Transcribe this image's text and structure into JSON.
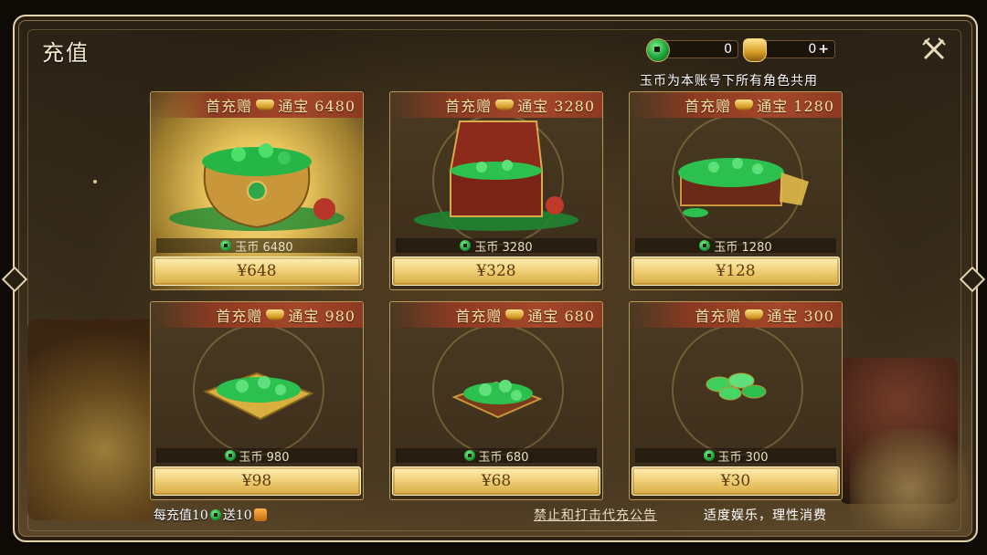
{
  "window": {
    "title": "充值"
  },
  "currency": {
    "jade": {
      "icon": "jade-coin-icon",
      "value": "0"
    },
    "ingot": {
      "icon": "gold-ingot-icon",
      "value": "0",
      "plus": "+"
    }
  },
  "note_shared": "玉币为本账号下所有角色共用",
  "packages": [
    {
      "bonus_prefix": "首充赠",
      "bonus_suffix": "通宝 6480",
      "amount_label": "玉币 6480",
      "price": "¥648",
      "art": "jade-pot"
    },
    {
      "bonus_prefix": "首充赠",
      "bonus_suffix": "通宝 3280",
      "amount_label": "玉币 3280",
      "price": "¥328",
      "art": "treasure-chest"
    },
    {
      "bonus_prefix": "首充赠",
      "bonus_suffix": "通宝 1280",
      "amount_label": "玉币 1280",
      "price": "¥128",
      "art": "coin-box"
    },
    {
      "bonus_prefix": "首充赠",
      "bonus_suffix": "通宝 980",
      "amount_label": "玉币 980",
      "price": "¥98",
      "art": "coin-cloth"
    },
    {
      "bonus_prefix": "首充赠",
      "bonus_suffix": "通宝 680",
      "amount_label": "玉币 680",
      "price": "¥68",
      "art": "coin-tray"
    },
    {
      "bonus_prefix": "首充赠",
      "bonus_suffix": "通宝 300",
      "amount_label": "玉币 300",
      "price": "¥30",
      "art": "coin-few"
    }
  ],
  "footer": {
    "promo_a": "每充值10",
    "promo_b": "送10",
    "notice_link": "禁止和打击代充公告",
    "advice": "适度娱乐，理性消费"
  },
  "colors": {
    "banner": "#a4472a",
    "gold_button": "#f1d27a",
    "jade": "#1da33b"
  }
}
